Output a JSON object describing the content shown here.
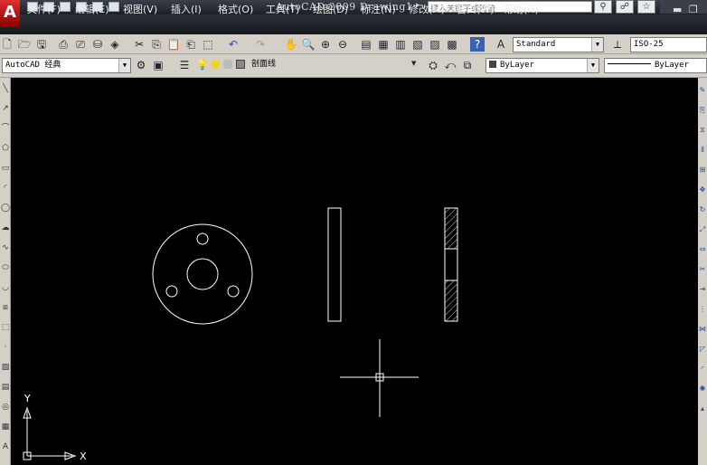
{
  "title": {
    "app_logo": "A",
    "text": "AutoCAD 2009  Drawing1",
    "search_placeholder": "键入关键字或短语",
    "quick_access_arrow": "▸"
  },
  "menus": [
    "文件(F)",
    "编辑(E)",
    "视图(V)",
    "插入(I)",
    "格式(O)",
    "工具(T)",
    "绘图(D)",
    "标注(N)",
    "修改(M)",
    "窗口(W)",
    "帮助(H)"
  ],
  "window_controls": {
    "minimize": "▬",
    "restore": "❐"
  },
  "toolbar": {
    "text_style": "Standard",
    "dim_style": "ISO-25"
  },
  "properties_bar": {
    "workspace": "AutoCAD 经典",
    "layer": "剖面线",
    "color": "ByLayer",
    "linetype": "ByLayer"
  },
  "ucs": {
    "x_label": "X",
    "y_label": "Y"
  },
  "colors": {
    "canvas_bg": "#000000",
    "entity": "#ffffff",
    "toolbar_bg": "#d4d0c8",
    "menu_bg": "#1c1f24"
  }
}
